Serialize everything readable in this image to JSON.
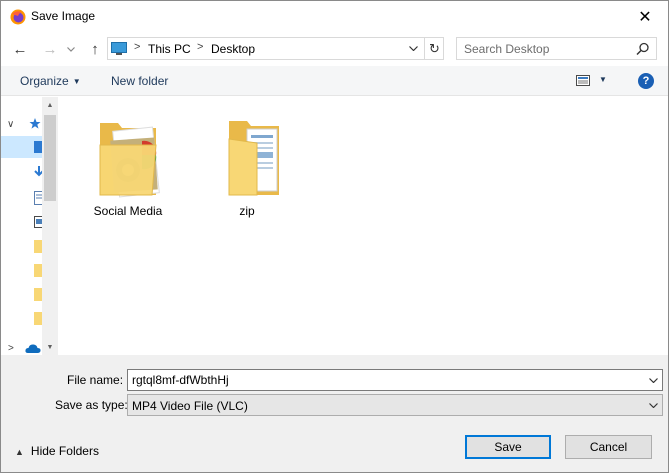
{
  "window": {
    "title": "Save Image",
    "close_glyph": "✕"
  },
  "nav": {
    "back_glyph": "←",
    "forward_glyph": "→",
    "recent_glyph": "⌄",
    "up_glyph": "↑"
  },
  "address": {
    "segments": [
      "This PC",
      "Desktop"
    ],
    "separator": ">",
    "refresh_glyph": "↻"
  },
  "search": {
    "placeholder": "Search Desktop"
  },
  "toolbar": {
    "organize_label": "Organize",
    "new_folder_label": "New folder",
    "help_label": "?"
  },
  "nav_pane": {
    "expand_glyph": "∨",
    "collapse_glyph": ">"
  },
  "files": [
    {
      "name": "Social Media"
    },
    {
      "name": "zip"
    }
  ],
  "form": {
    "filename_label": "File name:",
    "filename_value": "rgtql8mf-dfWbthHj",
    "filetype_label": "Save as type:",
    "filetype_value": "MP4 Video File (VLC)",
    "hide_folders_label": "Hide Folders",
    "save_label": "Save",
    "cancel_label": "Cancel"
  },
  "colors": {
    "accent": "#0078d7",
    "selection": "#cce8ff",
    "folder": "#f8d775",
    "help": "#1a5fb4"
  }
}
